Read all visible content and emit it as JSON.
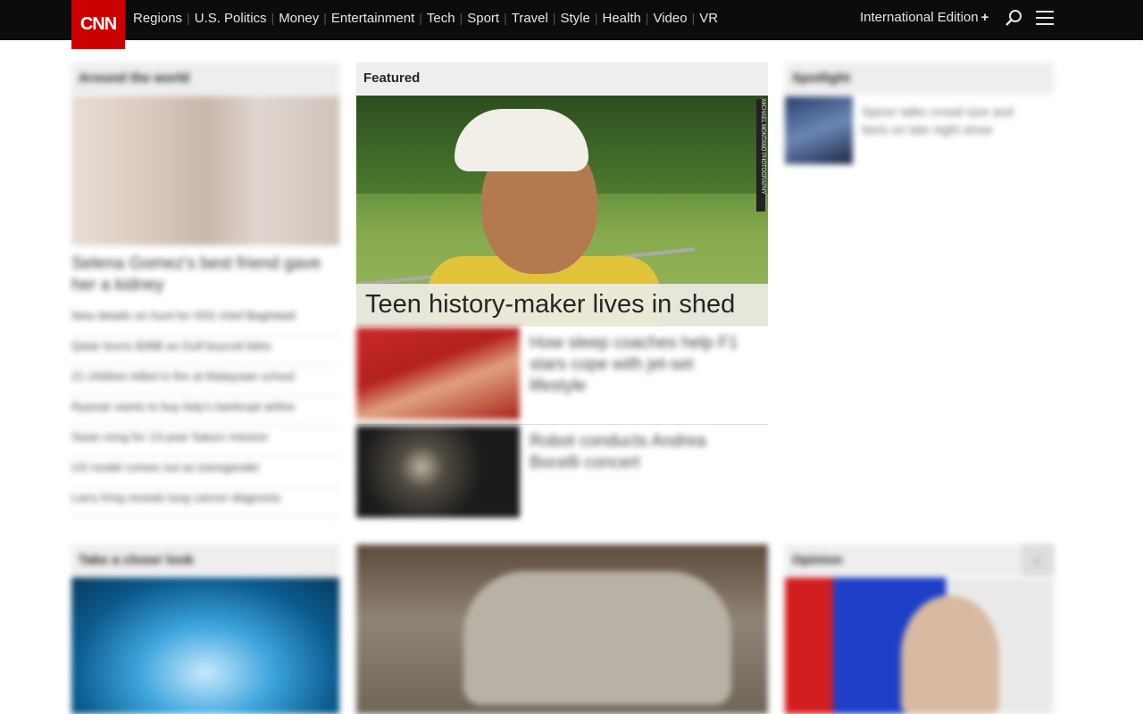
{
  "brand": {
    "logo_text": "CNN",
    "accent": "#cc0000"
  },
  "nav": {
    "items": [
      "Regions",
      "U.S. Politics",
      "Money",
      "Entertainment",
      "Tech",
      "Sport",
      "Travel",
      "Style",
      "Health",
      "Video",
      "VR"
    ],
    "edition": "International Edition",
    "edition_plus": "+"
  },
  "around": {
    "header": "Around the world",
    "headline": "Selena Gomez's best friend gave her a kidney",
    "links": [
      "New details on hunt for ISIS chief Baghdadi",
      "Qatar burns $38B as Gulf boycott bites",
      "21 children killed in fire at Malaysian school",
      "Ryanair wants to buy Italy's bankrupt airline",
      "Swan song for 13-year Saturn mission",
      "US model comes out as transgender",
      "Larry King reveals lung cancer diagnosis"
    ]
  },
  "featured": {
    "header": "Featured",
    "headline": "Teen history-maker lives in shed",
    "photo_credit": "MICHAEL MONTANO PHOTOGRAPHY",
    "cards": [
      {
        "title": "How sleep coaches help F1 stars cope with jet-set lifestyle"
      },
      {
        "title": "Robot conducts Andrea Bocelli concert"
      }
    ]
  },
  "spotlight": {
    "header": "Spotlight",
    "title": "Spicer talks crowd size and facts on late night show"
  },
  "closer": {
    "header": "Take a closer look"
  },
  "opinion": {
    "header": "Opinion",
    "arrow": "›"
  }
}
